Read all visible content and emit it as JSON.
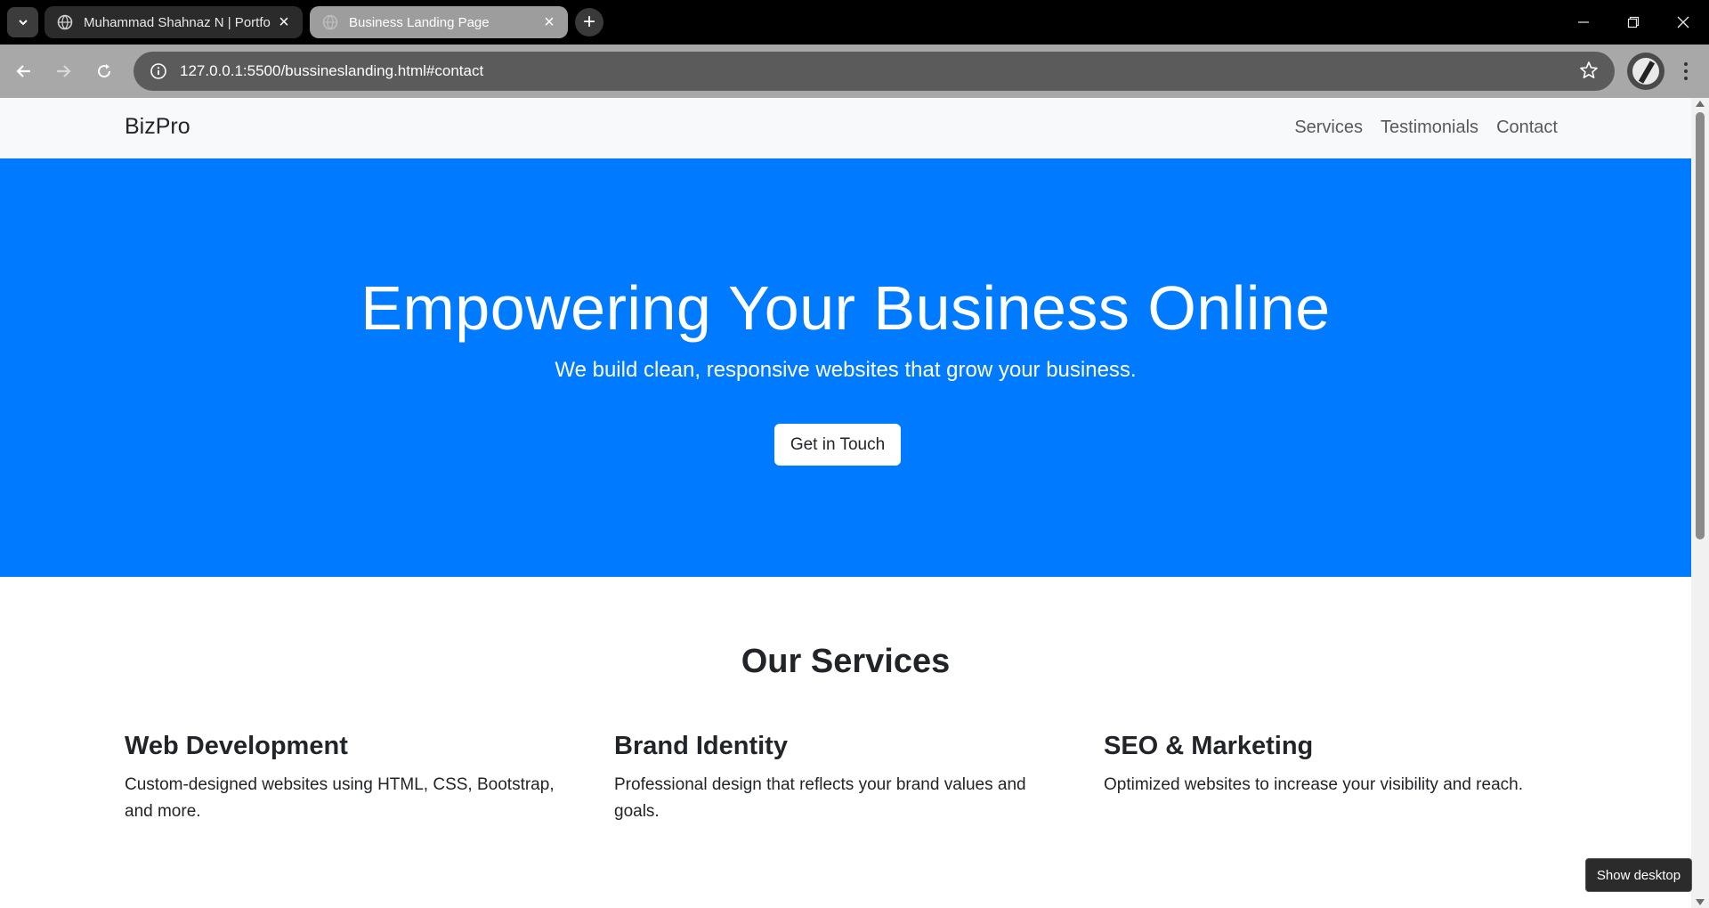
{
  "browser": {
    "tabs": [
      {
        "title": "Muhammad Shahnaz N | Portfo",
        "active": false
      },
      {
        "title": "Business Landing Page",
        "active": true
      }
    ],
    "url": "127.0.0.1:5500/bussineslanding.html#contact"
  },
  "site": {
    "brand": "BizPro",
    "nav": [
      "Services",
      "Testimonials",
      "Contact"
    ],
    "hero": {
      "title": "Empowering Your Business Online",
      "subtitle": "We build clean, responsive websites that grow your business.",
      "cta": "Get in Touch",
      "color": "#007bff"
    },
    "services": {
      "title": "Our Services",
      "items": [
        {
          "title": "Web Development",
          "desc": "Custom-designed websites using HTML, CSS, Bootstrap, and more."
        },
        {
          "title": "Brand Identity",
          "desc": "Professional design that reflects your brand values and goals."
        },
        {
          "title": "SEO & Marketing",
          "desc": "Optimized websites to increase your visibility and reach."
        }
      ]
    }
  },
  "tooltip": "Show desktop"
}
